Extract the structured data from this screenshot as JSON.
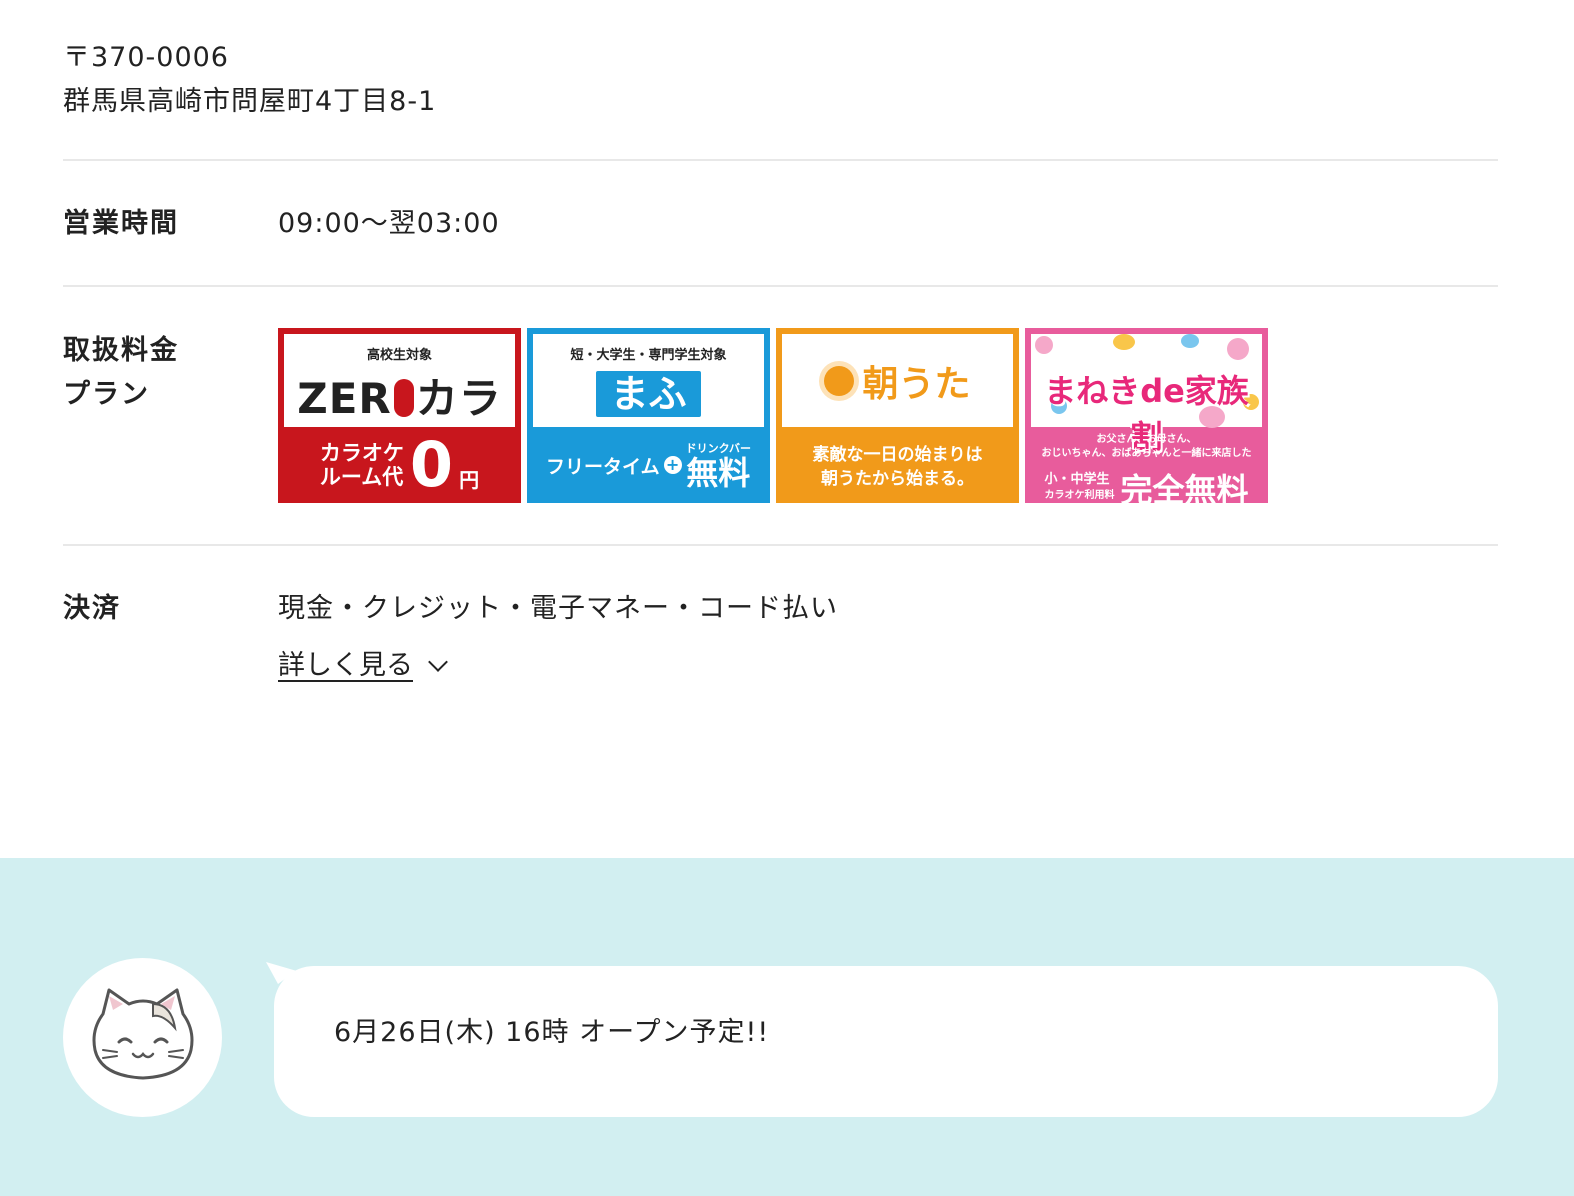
{
  "address": {
    "postal": "〒370-0006",
    "line": "群馬県高崎市問屋町4丁目8-1"
  },
  "hours": {
    "label": "営業時間",
    "value": "09:00〜翌03:00"
  },
  "plans": {
    "label_line1": "取扱料金",
    "label_line2": "プラン",
    "banners": [
      {
        "name": "ZERO カラ",
        "top_small": "高校生対象",
        "logo_left": "ZER",
        "logo_right": "カラ",
        "line1": "カラオケ",
        "line2": "ルーム代",
        "big": "0",
        "unit": "円",
        "color": "#c8161d"
      },
      {
        "name": "まふ",
        "top_small": "短・大学生・専門学生対象",
        "logo": "まふ",
        "line1": "フリータイム",
        "plus": "+",
        "small": "ドリンクバー",
        "big": "無料",
        "color": "#1a9ad9"
      },
      {
        "name": "朝うた",
        "logo": "朝うた",
        "line1": "素敵な一日の始まりは",
        "line2": "朝うたから始まる。",
        "color": "#f19a1a"
      },
      {
        "name": "まねきde家族割",
        "logo": "まねきde家族割",
        "note1": "お父さん、お母さん、",
        "note2": "おじいちゃん、おばあちゃんと一緒に来店した",
        "sub1": "小・中学生",
        "sub2": "カラオケ利用料",
        "big": "完全無料",
        "color": "#e85c9c"
      }
    ]
  },
  "payment": {
    "label": "決済",
    "value": "現金・クレジット・電子マネー・コード払い",
    "more_link": "詳しく見る"
  },
  "notice": {
    "message": "6月26日(木) 16時 オープン予定!!"
  },
  "icons": [
    "chevron-down-icon",
    "cat-avatar-icon"
  ],
  "colors": {
    "notice_bg": "#d2eff1",
    "divider": "#e8e8e8"
  }
}
